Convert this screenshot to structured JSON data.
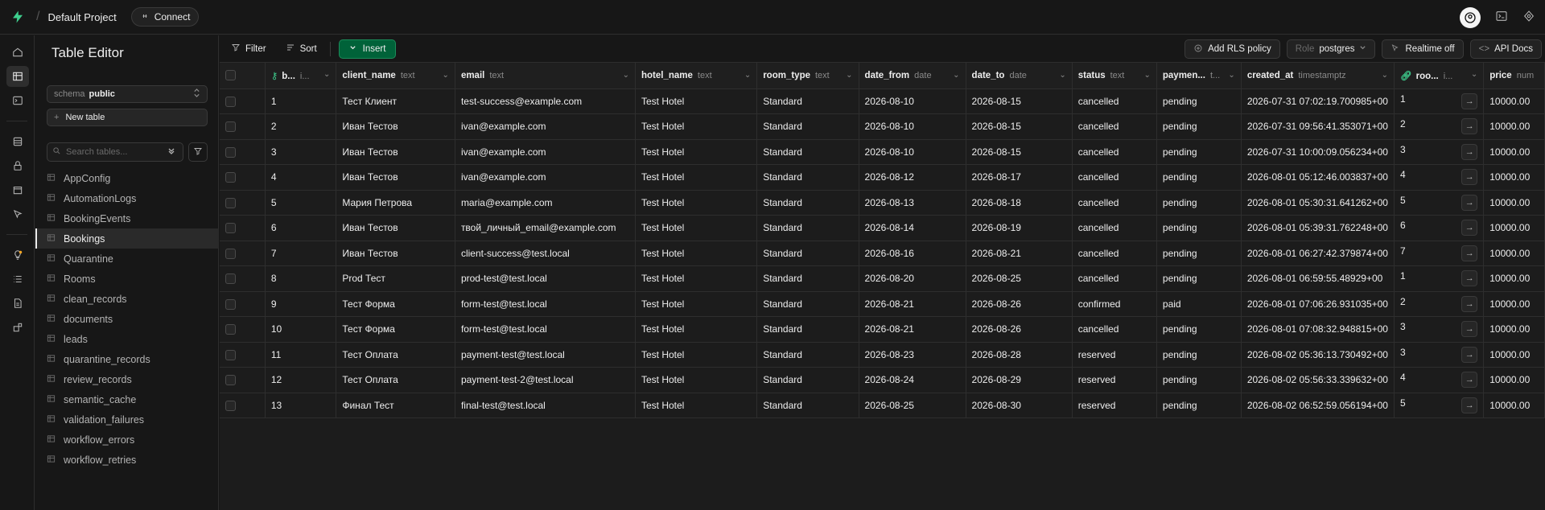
{
  "project": {
    "name": "Default Project",
    "connect_label": "Connect"
  },
  "sidebar": {
    "title": "Table Editor",
    "schema_label": "schema",
    "schema_value": "public",
    "new_table_label": "New table",
    "search_placeholder": "Search tables...",
    "tables": [
      "AppConfig",
      "AutomationLogs",
      "BookingEvents",
      "Bookings",
      "Quarantine",
      "Rooms",
      "clean_records",
      "documents",
      "leads",
      "quarantine_records",
      "review_records",
      "semantic_cache",
      "validation_failures",
      "workflow_errors",
      "workflow_retries"
    ],
    "active_table": "Bookings"
  },
  "toolbar": {
    "filter_label": "Filter",
    "sort_label": "Sort",
    "insert_label": "Insert",
    "rls_label": "Add RLS policy",
    "role_prefix": "Role",
    "role_value": "postgres",
    "realtime_label": "Realtime off",
    "api_docs_label": "API Docs"
  },
  "columns": [
    {
      "name": "b...",
      "type": "i..."
    },
    {
      "name": "client_name",
      "type": "text"
    },
    {
      "name": "email",
      "type": "text"
    },
    {
      "name": "hotel_name",
      "type": "text"
    },
    {
      "name": "room_type",
      "type": "text"
    },
    {
      "name": "date_from",
      "type": "date"
    },
    {
      "name": "date_to",
      "type": "date"
    },
    {
      "name": "status",
      "type": "text"
    },
    {
      "name": "paymen...",
      "type": "t..."
    },
    {
      "name": "created_at",
      "type": "timestamptz"
    },
    {
      "name": "roo...",
      "type": "i..."
    },
    {
      "name": "price",
      "type": "num"
    }
  ],
  "rows": [
    [
      "1",
      "Тест Клиент",
      "test-success@example.com",
      "Test Hotel",
      "Standard",
      "2026-08-10",
      "2026-08-15",
      "cancelled",
      "pending",
      "2026-07-31 07:02:19.700985+00",
      "1",
      "10000.00"
    ],
    [
      "2",
      "Иван Тестов",
      "ivan@example.com",
      "Test Hotel",
      "Standard",
      "2026-08-10",
      "2026-08-15",
      "cancelled",
      "pending",
      "2026-07-31 09:56:41.353071+00",
      "2",
      "10000.00"
    ],
    [
      "3",
      "Иван Тестов",
      "ivan@example.com",
      "Test Hotel",
      "Standard",
      "2026-08-10",
      "2026-08-15",
      "cancelled",
      "pending",
      "2026-07-31 10:00:09.056234+00",
      "3",
      "10000.00"
    ],
    [
      "4",
      "Иван Тестов",
      "ivan@example.com",
      "Test Hotel",
      "Standard",
      "2026-08-12",
      "2026-08-17",
      "cancelled",
      "pending",
      "2026-08-01 05:12:46.003837+00",
      "4",
      "10000.00"
    ],
    [
      "5",
      "Мария Петрова",
      "maria@example.com",
      "Test Hotel",
      "Standard",
      "2026-08-13",
      "2026-08-18",
      "cancelled",
      "pending",
      "2026-08-01 05:30:31.641262+00",
      "5",
      "10000.00"
    ],
    [
      "6",
      "Иван Тестов",
      "твой_личный_email@example.com",
      "Test Hotel",
      "Standard",
      "2026-08-14",
      "2026-08-19",
      "cancelled",
      "pending",
      "2026-08-01 05:39:31.762248+00",
      "6",
      "10000.00"
    ],
    [
      "7",
      "Иван Тестов",
      "client-success@test.local",
      "Test Hotel",
      "Standard",
      "2026-08-16",
      "2026-08-21",
      "cancelled",
      "pending",
      "2026-08-01 06:27:42.379874+00",
      "7",
      "10000.00"
    ],
    [
      "8",
      "Prod Тест",
      "prod-test@test.local",
      "Test Hotel",
      "Standard",
      "2026-08-20",
      "2026-08-25",
      "cancelled",
      "pending",
      "2026-08-01 06:59:55.48929+00",
      "1",
      "10000.00"
    ],
    [
      "9",
      "Тест Форма",
      "form-test@test.local",
      "Test Hotel",
      "Standard",
      "2026-08-21",
      "2026-08-26",
      "confirmed",
      "paid",
      "2026-08-01 07:06:26.931035+00",
      "2",
      "10000.00"
    ],
    [
      "10",
      "Тест Форма",
      "form-test@test.local",
      "Test Hotel",
      "Standard",
      "2026-08-21",
      "2026-08-26",
      "cancelled",
      "pending",
      "2026-08-01 07:08:32.948815+00",
      "3",
      "10000.00"
    ],
    [
      "11",
      "Тест Оплата",
      "payment-test@test.local",
      "Test Hotel",
      "Standard",
      "2026-08-23",
      "2026-08-28",
      "reserved",
      "pending",
      "2026-08-02 05:36:13.730492+00",
      "3",
      "10000.00"
    ],
    [
      "12",
      "Тест Оплата",
      "payment-test-2@test.local",
      "Test Hotel",
      "Standard",
      "2026-08-24",
      "2026-08-29",
      "reserved",
      "pending",
      "2026-08-02 05:56:33.339632+00",
      "4",
      "10000.00"
    ],
    [
      "13",
      "Финал Тест",
      "final-test@test.local",
      "Test Hotel",
      "Standard",
      "2026-08-25",
      "2026-08-30",
      "reserved",
      "pending",
      "2026-08-02 06:52:59.056194+00",
      "5",
      "10000.00"
    ]
  ],
  "colors": {
    "accent": "#3ecf8e",
    "insert_bg": "#006239",
    "bg": "#1c1c1c"
  },
  "icons": {
    "logo": "supabase-bolt-icon",
    "connect": "plug-icon",
    "avatar": "user-avatar-icon",
    "terminal": "terminal-icon",
    "settings": "gear-icon"
  }
}
